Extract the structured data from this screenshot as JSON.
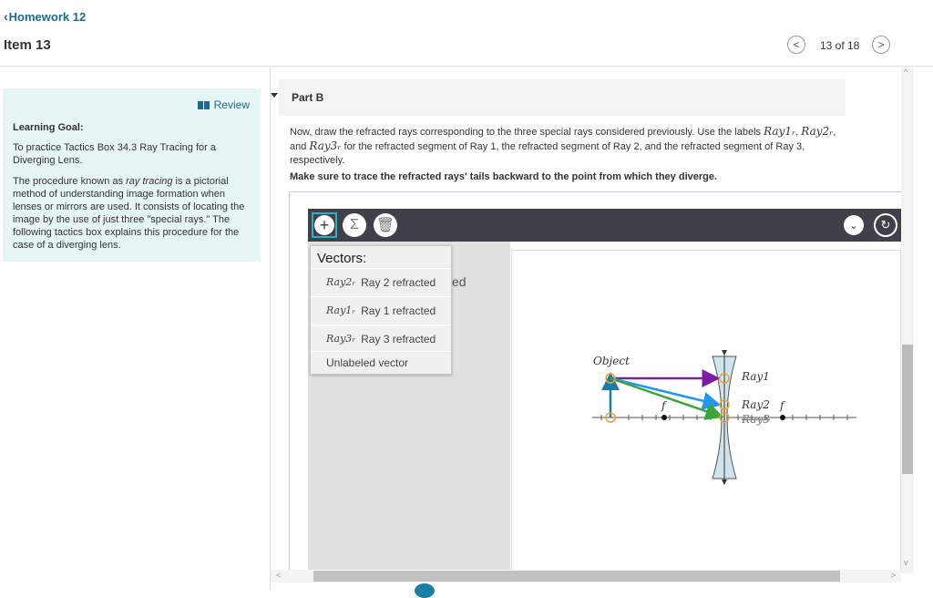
{
  "header": {
    "back_label": "Homework 12",
    "item_title": "Item 13",
    "position": "13 of 18",
    "prev_glyph": "<",
    "next_glyph": ">"
  },
  "left_panel": {
    "review_label": "Review",
    "learning_goal_title": "Learning Goal:",
    "learning_goal_text": "To practice Tactics Box 34.3 Ray Tracing for a Diverging Lens.",
    "paragraph_prefix": "The procedure known as ",
    "paragraph_em": "ray tracing",
    "paragraph_suffix": " is a pictorial method of understanding image formation when lenses or mirrors are used. It consists of locating the image by the use of just three \"special rays.\" The following tactics box explains this procedure for the case of a diverging lens."
  },
  "part": {
    "label": "Part B",
    "instruction_1": "Now, draw the refracted rays corresponding to the three special rays considered previously. Use the labels ",
    "math_ray1": "Ray1ᵣ",
    "sep_1": ", ",
    "math_ray2": "Ray2ᵣ",
    "sep_2": ", and ",
    "math_ray3": "Ray3ᵣ",
    "instruction_2": " for the refracted segment of Ray 1, the refracted segment of Ray 2, and the refracted segment of Ray 3, respectively.",
    "note": "Make sure to trace the refracted rays' tails backward to the point from which they diverge."
  },
  "toolbar": {
    "add_glyph": "+",
    "sum_glyph": "Σ",
    "trash_glyph": "🗑",
    "down_glyph": "⌄",
    "reset_glyph": "↻"
  },
  "menu": {
    "title": "Vectors:",
    "items": [
      {
        "math": "Ray2ᵣ",
        "label": "Ray 2 refracted"
      },
      {
        "math": "Ray1ᵣ",
        "label": "Ray 1 refracted"
      },
      {
        "math": "Ray3ᵣ",
        "label": "Ray 3 refracted"
      },
      {
        "math": "",
        "label": "Unlabeled vector"
      }
    ]
  },
  "behind_text": "ed",
  "diagram": {
    "object_label": "Object",
    "ray1_label": "Ray1",
    "ray2_label": "Ray2",
    "ray3_label": "Ray3",
    "f_left_label": "f",
    "f_right_label": "f",
    "colors": {
      "ray1": "#7b1fa2",
      "ray2": "#2196f3",
      "ray3": "#3aa63a",
      "object": "#1a7fa3",
      "handle": "#f0a030",
      "lens_fill": "#cfe4ec"
    }
  },
  "scroll": {
    "up": "^",
    "down": "v",
    "left": "<",
    "right": ">"
  }
}
